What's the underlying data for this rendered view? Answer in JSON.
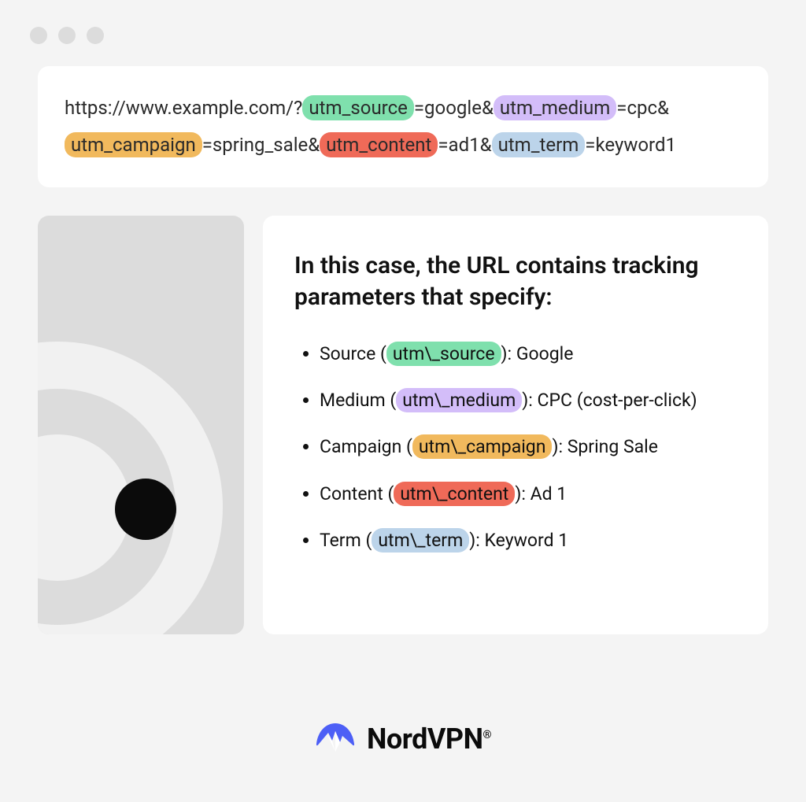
{
  "url": {
    "parts": [
      {
        "text": "https://www.example.com/?",
        "highlight": null
      },
      {
        "text": "utm_source",
        "highlight": "green"
      },
      {
        "text": "=google&",
        "highlight": null
      },
      {
        "text": "utm_medium",
        "highlight": "purple"
      },
      {
        "text": "=cpc&",
        "highlight": null
      },
      {
        "text": "utm_campaign",
        "highlight": "orange"
      },
      {
        "text": "=spring_sale&",
        "highlight": null
      },
      {
        "text": "utm_content",
        "highlight": "red"
      },
      {
        "text": "=ad1&",
        "highlight": null
      },
      {
        "text": "utm_term",
        "highlight": "blue"
      },
      {
        "text": "=keyword1",
        "highlight": null
      }
    ]
  },
  "description": {
    "title": "In this case, the URL contains tracking parameters that specify:",
    "items": [
      {
        "label": "Source",
        "param": "utm\\_source",
        "highlight": "green",
        "value": "Google"
      },
      {
        "label": "Medium",
        "param": "utm\\_medium",
        "highlight": "purple",
        "value": "CPC (cost-per-click)"
      },
      {
        "label": "Campaign",
        "param": "utm\\_campaign",
        "highlight": "orange",
        "value": "Spring Sale"
      },
      {
        "label": "Content",
        "param": "utm\\_content",
        "highlight": "red",
        "value": "Ad 1"
      },
      {
        "label": "Term",
        "param": "utm\\_term",
        "highlight": "blue",
        "value": "Keyword 1"
      }
    ]
  },
  "brand": {
    "name": "NordVPN",
    "registered": "®",
    "icon": "nordvpn-logo-icon",
    "accent_color": "#4d5ff6"
  },
  "highlight_colors": {
    "green": "#7fe0ad",
    "purple": "#d3bdf9",
    "orange": "#f1b95d",
    "red": "#ef6a58",
    "blue": "#bcd4ea"
  }
}
